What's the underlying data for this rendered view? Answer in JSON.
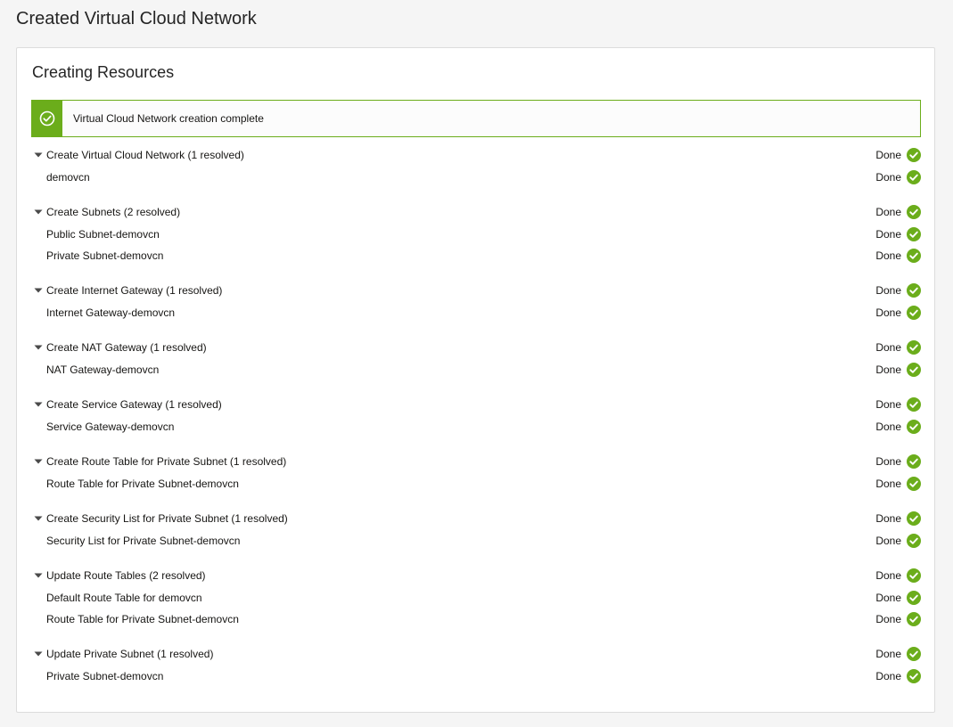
{
  "page": {
    "title": "Created Virtual Cloud Network"
  },
  "panel": {
    "title": "Creating Resources"
  },
  "banner": {
    "message": "Virtual Cloud Network creation complete",
    "icon": "check-circle-outline-icon",
    "color": "#6bad1b"
  },
  "status_color": "#6bad1b",
  "groups": [
    {
      "label": "Create Virtual Cloud Network (1 resolved)",
      "status": "Done",
      "items": [
        {
          "label": "demovcn",
          "status": "Done"
        }
      ]
    },
    {
      "label": "Create Subnets (2 resolved)",
      "status": "Done",
      "items": [
        {
          "label": "Public Subnet-demovcn",
          "status": "Done"
        },
        {
          "label": "Private Subnet-demovcn",
          "status": "Done"
        }
      ]
    },
    {
      "label": "Create Internet Gateway (1 resolved)",
      "status": "Done",
      "items": [
        {
          "label": "Internet Gateway-demovcn",
          "status": "Done"
        }
      ]
    },
    {
      "label": "Create NAT Gateway (1 resolved)",
      "status": "Done",
      "items": [
        {
          "label": "NAT Gateway-demovcn",
          "status": "Done"
        }
      ]
    },
    {
      "label": "Create Service Gateway (1 resolved)",
      "status": "Done",
      "items": [
        {
          "label": "Service Gateway-demovcn",
          "status": "Done"
        }
      ]
    },
    {
      "label": "Create Route Table for Private Subnet (1 resolved)",
      "status": "Done",
      "items": [
        {
          "label": "Route Table for Private Subnet-demovcn",
          "status": "Done"
        }
      ]
    },
    {
      "label": "Create Security List for Private Subnet (1 resolved)",
      "status": "Done",
      "items": [
        {
          "label": "Security List for Private Subnet-demovcn",
          "status": "Done"
        }
      ]
    },
    {
      "label": "Update Route Tables (2 resolved)",
      "status": "Done",
      "items": [
        {
          "label": "Default Route Table for demovcn",
          "status": "Done"
        },
        {
          "label": "Route Table for Private Subnet-demovcn",
          "status": "Done"
        }
      ]
    },
    {
      "label": "Update Private Subnet (1 resolved)",
      "status": "Done",
      "items": [
        {
          "label": "Private Subnet-demovcn",
          "status": "Done"
        }
      ]
    }
  ]
}
